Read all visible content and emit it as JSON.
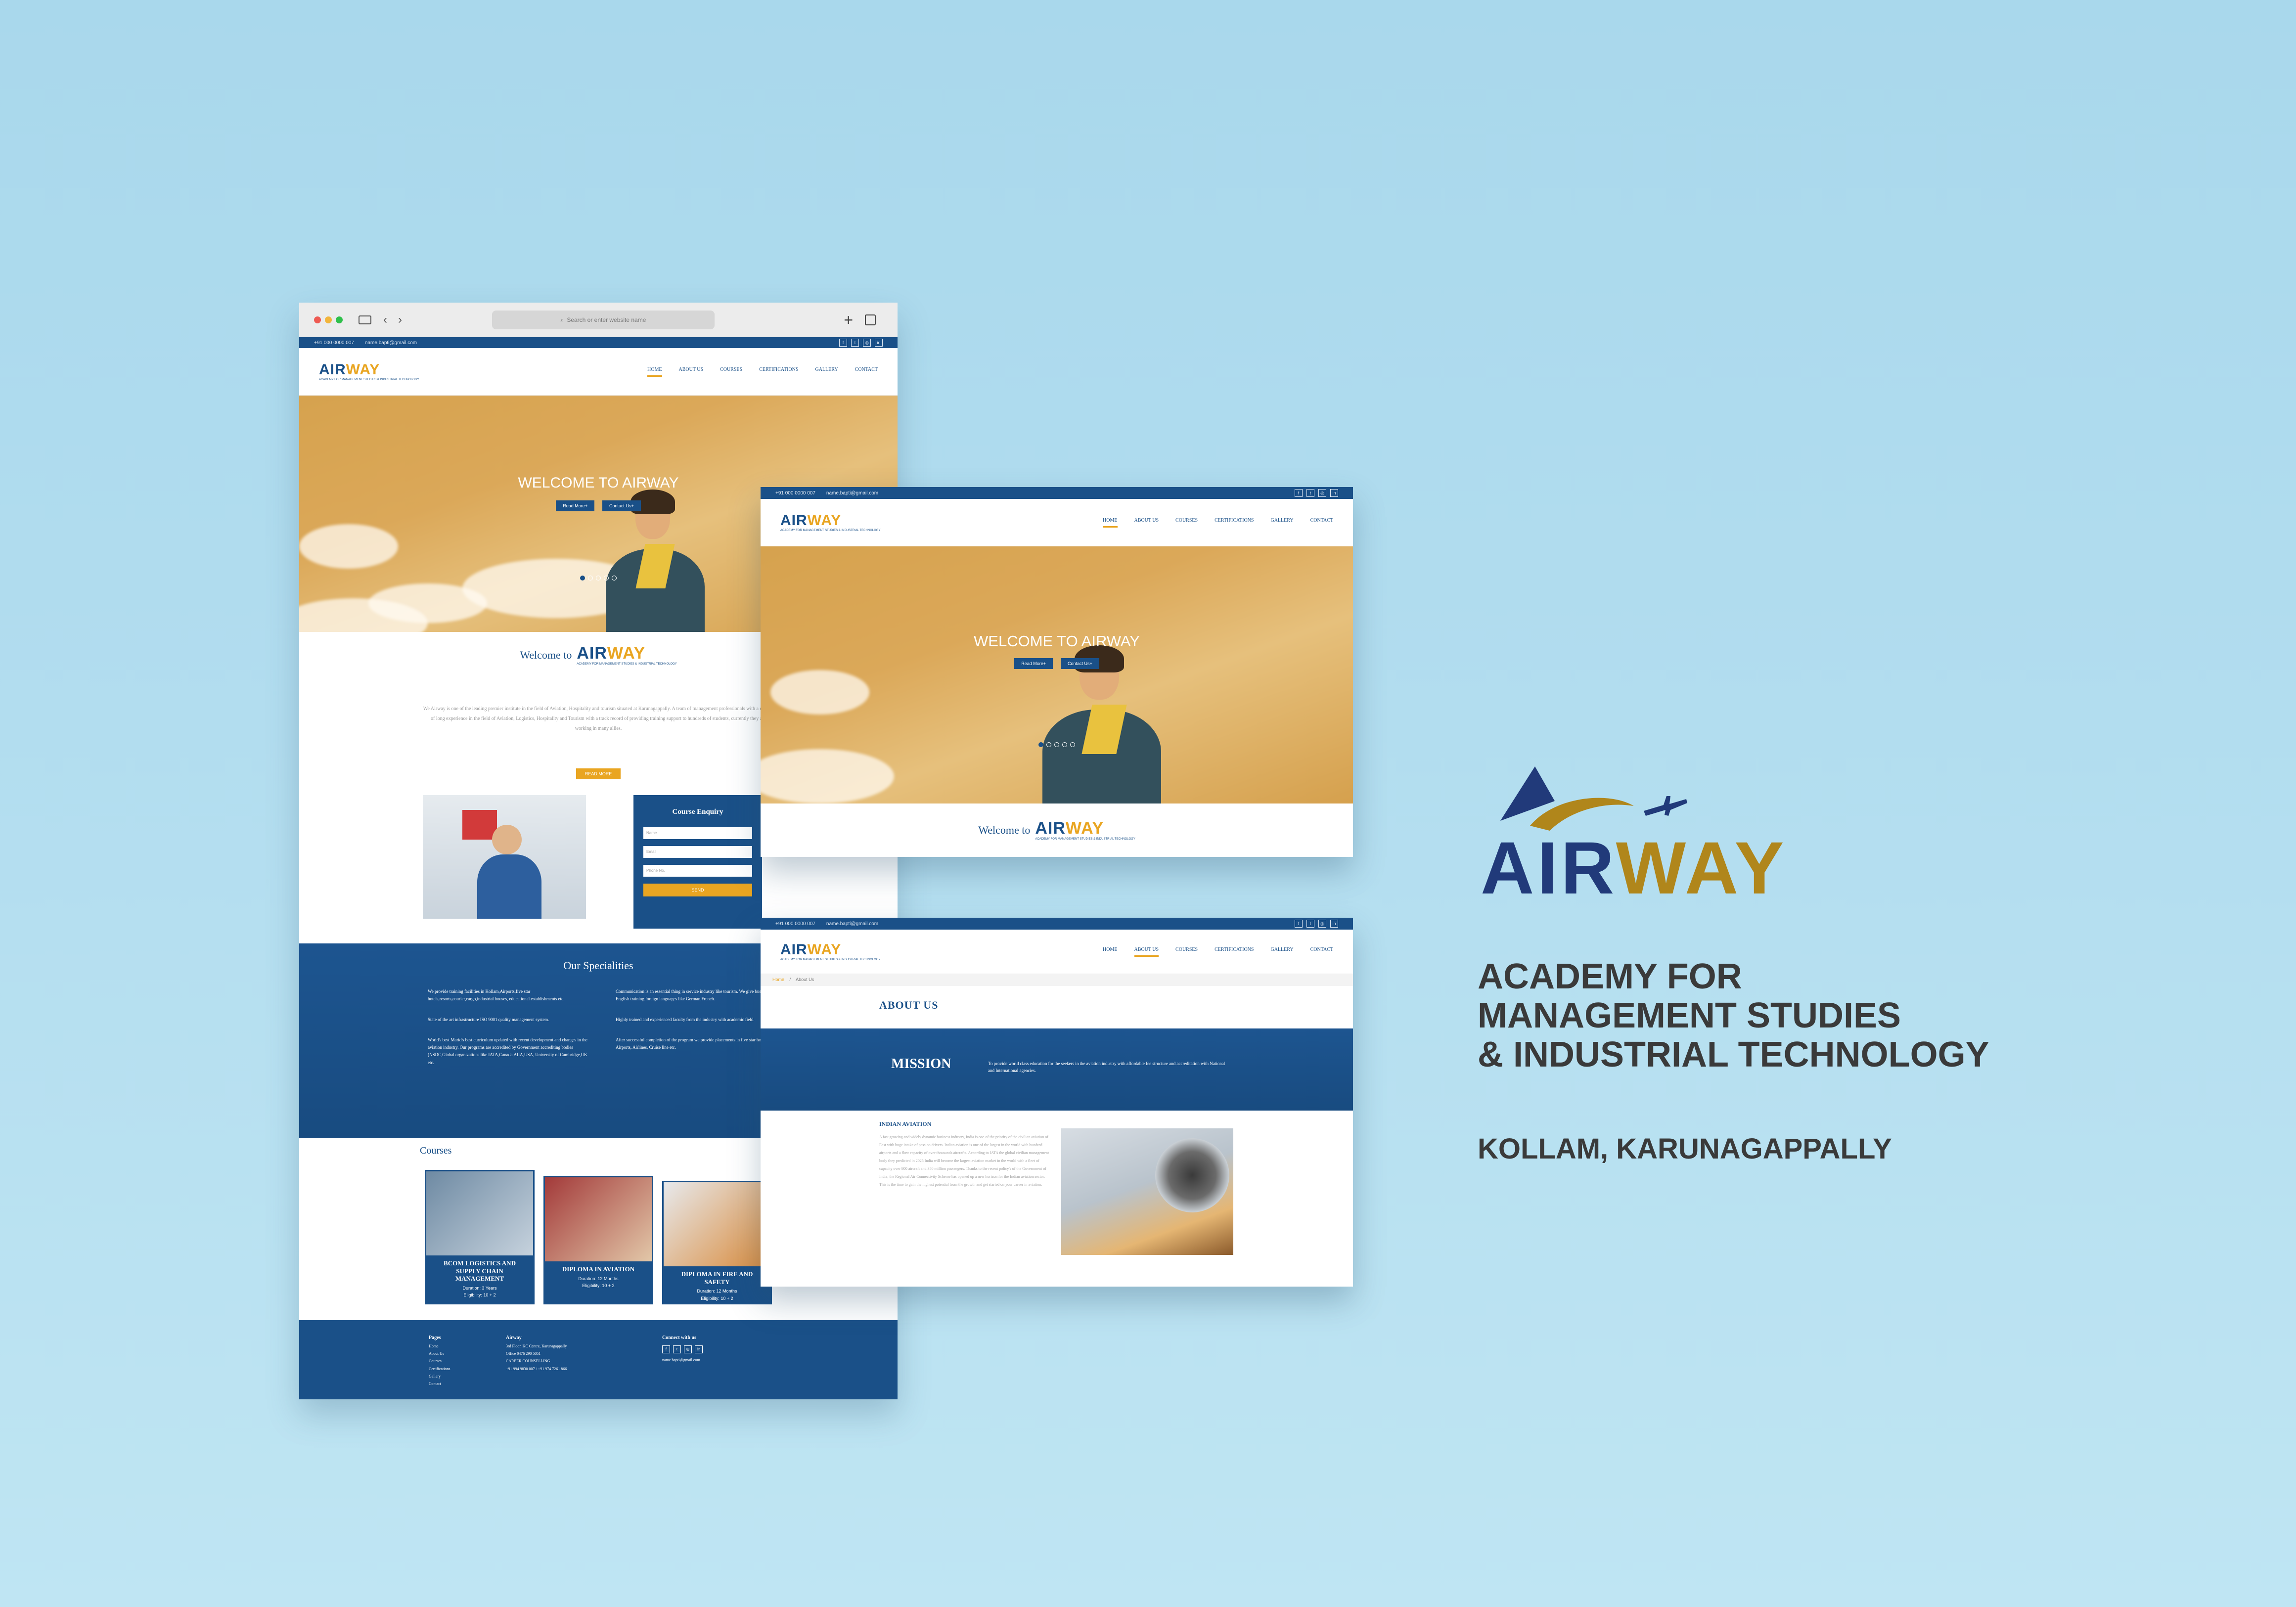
{
  "browser": {
    "search_placeholder": "Search or enter website name"
  },
  "site": {
    "phone": "+91 000 0000 007",
    "email": "name.bapti@gmail.com",
    "nav": [
      "HOME",
      "ABOUT US",
      "COURSES",
      "CERTIFICATIONS",
      "GALLERY",
      "CONTACT"
    ],
    "logo_word_1": "AIR",
    "logo_word_2": "WAY",
    "logo_sub": "ACADEMY FOR MANAGEMENT STUDIES & INDUSTRIAL TECHNOLOGY",
    "hero_title": "WELCOME TO AIRWAY",
    "hero_btn_1": "Read More+",
    "hero_btn_2": "Contact Us+",
    "welcome_prefix": "Welcome to",
    "welcome_text": "We Airway is one of the leading premier institute in the field of Aviation, Hospitality and tourism situated at Karunagappally. A team of management professionals with a decade of long experience in the field of Aviation, Logistics, Hospitality and Tourism with a track record of providing training support to hundreds of students, currently they are working in many allies.",
    "read_more": "READ MORE",
    "enquiry_title": "Course Enquiry",
    "enquiry_fields": [
      "Name",
      "Email",
      "Phone No."
    ],
    "enquiry_send": "SEND",
    "specialities_title": "Our Specialities",
    "specialities": [
      "We provide training facilities in Kollam,Airports,five star hotels,resorts,courier,cargo,industrial houses, educational establishments etc.",
      "State of the art infrastructure ISO 9001 quality management system.",
      "World's best Marid's best curriculum updated with recent development and changes in the aviation industry. Our programs are accredited by Government accrediting bodies (NSDC,Global organizations like IATA,Canada,AIIA,USA, University of Cambridge,UK etc.",
      "Communication is an essential thing in service industry like tourism. We give business English training foreign languages like German,French.",
      "Highly trained and experienced faculty from the industry with academic field.",
      "After successful completion of the program we provide placements in five star hotels, Airports, Airlines, Cruise line etc."
    ],
    "courses_title": "Courses",
    "courses": [
      {
        "name": "BCOM LOGISTICS AND SUPPLY CHAIN MANAGEMENT",
        "duration": "Duration: 3 Years",
        "eligibility": "Eligibility: 10 + 2"
      },
      {
        "name": "DIPLOMA IN AVIATION",
        "duration": "Duration: 12 Months",
        "eligibility": "Eligibility: 10 + 2"
      },
      {
        "name": "DIPLOMA IN FIRE AND SAFETY",
        "duration": "Duration: 12 Months",
        "eligibility": "Eligibility: 10 + 2"
      }
    ],
    "footer": {
      "pages_title": "Pages",
      "pages": [
        "Home",
        "About Us",
        "Courses",
        "Certifications",
        "Gallery",
        "Contact"
      ],
      "addr_title": "Airway",
      "addr_lines": [
        "3rd Floor, KC Centre, Karunagappally",
        "Office 0476 290 5051",
        "CAREER COUNSELLING",
        "+91 994 9830 007 / +91 974 7261 866"
      ],
      "connect_title": "Connect with us",
      "connect_email": "name.bapti@gmail.com"
    },
    "about": {
      "breadcrumb_home": "Home",
      "breadcrumb_current": "About Us",
      "title": "ABOUT US",
      "mission_title": "MISSION",
      "mission_text": "To provide world class education for the seekers in the aviation industry with affordable fee structure and accreditation with National and International agencies.",
      "indian_aviation_title": "INDIAN AVIATION",
      "indian_aviation_text": "A fast growing and widely dynamic business industry, India is one of the priority of the civilian aviation of East with huge intake of passion drivers. Indian aviation is one of the largest in the world with hundred airports and a flow capacity of over thousands aircrafts. According to IATA the global civilian management body they predicted in 2025 India will become the largest aviation market in the world with a fleet of capacity over 800 aircraft and 350 million passengers. Thanks to the recent policy's of the Government of India, the Regional Air Connectivity Scheme has opened up a new horizon for the Indian aviation sector. This is the time to gain the highest potential from the growth and get started on your career in aviation."
    }
  },
  "brand": {
    "logo_word_1": "AIR",
    "logo_word_2": "WAY",
    "headline_1": "ACADEMY FOR",
    "headline_2": "MANAGEMENT STUDIES",
    "headline_3": "& INDUSTRIAL TECHNOLOGY",
    "location": "KOLLAM, KARUNAGAPPALLY"
  },
  "colors": {
    "navy": "#1a5088",
    "gold": "#e9a521",
    "brand_navy": "#213a7a",
    "brand_gold": "#b0861b",
    "text_dark": "#3a3a3a"
  }
}
